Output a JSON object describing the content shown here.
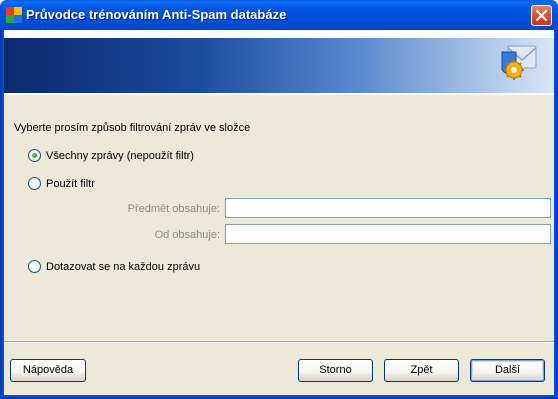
{
  "window": {
    "title": "Průvodce trénováním Anti-Spam databáze",
    "colors": {
      "titlebar": "#0054e3",
      "banner_dark": "#0b2a6e",
      "face": "#ece9d8"
    }
  },
  "icons": {
    "app": "avg-logo-icon",
    "close": "close-icon",
    "banner": "mail-gear-shield-icon"
  },
  "main": {
    "prompt": "Vyberte prosím způsob filtrování zpráv ve složce",
    "options": [
      {
        "label": "Všechny zprávy (nepoužít filtr)",
        "checked": true
      },
      {
        "label": "Použít filtr",
        "checked": false
      },
      {
        "label": "Dotazovat se na každou zprávu",
        "checked": false
      }
    ],
    "filter": {
      "subject_label": "Předmět obsahuje:",
      "subject_value": "",
      "from_label": "Od obsahuje:",
      "from_value": ""
    }
  },
  "footer": {
    "help_label": "Nápověda",
    "cancel_label": "Storno",
    "back_label": "Zpět",
    "next_label": "Další"
  }
}
